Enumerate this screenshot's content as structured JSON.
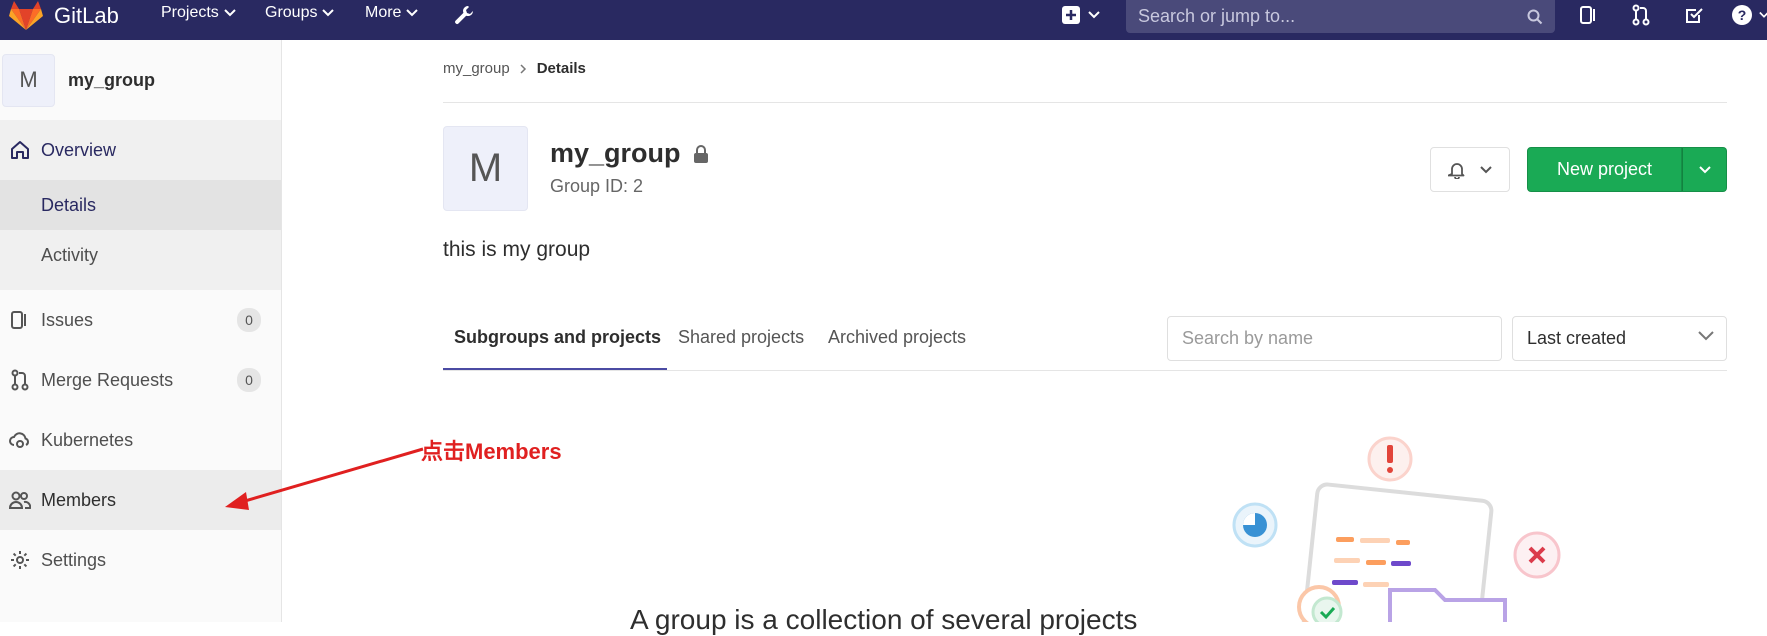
{
  "navbar": {
    "brand": "GitLab",
    "menus": [
      {
        "label": "Projects",
        "icon": "chevron-down-icon"
      },
      {
        "label": "Groups",
        "icon": "chevron-down-icon"
      },
      {
        "label": "More",
        "icon": "chevron-down-icon"
      }
    ],
    "search_placeholder": "Search or jump to...",
    "colors": {
      "background": "#292961"
    }
  },
  "sidebar": {
    "context": {
      "avatar_letter": "M",
      "name": "my_group"
    },
    "items": [
      {
        "label": "Overview",
        "icon": "home-icon"
      },
      {
        "label": "Details"
      },
      {
        "label": "Activity"
      },
      {
        "label": "Issues",
        "icon": "issues-icon",
        "count": "0"
      },
      {
        "label": "Merge Requests",
        "icon": "merge-request-icon",
        "count": "0"
      },
      {
        "label": "Kubernetes",
        "icon": "cloud-gear-icon"
      },
      {
        "label": "Members",
        "icon": "users-icon"
      },
      {
        "label": "Settings",
        "icon": "gear-icon"
      }
    ]
  },
  "breadcrumb": {
    "parent": "my_group",
    "current": "Details"
  },
  "group": {
    "avatar_letter": "M",
    "name": "my_group",
    "id_text": "Group ID: 2",
    "description": "this is my group"
  },
  "actions": {
    "new_project": "New project"
  },
  "tabs": [
    {
      "label": "Subgroups and projects",
      "active": true
    },
    {
      "label": "Shared projects",
      "active": false
    },
    {
      "label": "Archived projects",
      "active": false
    }
  ],
  "filter": {
    "search_placeholder": "Search by name",
    "sort_selected": "Last created"
  },
  "annotation": {
    "text": "点击Members",
    "color": "#e02020"
  },
  "empty_state": {
    "title": "A group is a collection of several projects"
  },
  "colors": {
    "accent": "#4b4ba3",
    "success": "#1aaa55"
  }
}
